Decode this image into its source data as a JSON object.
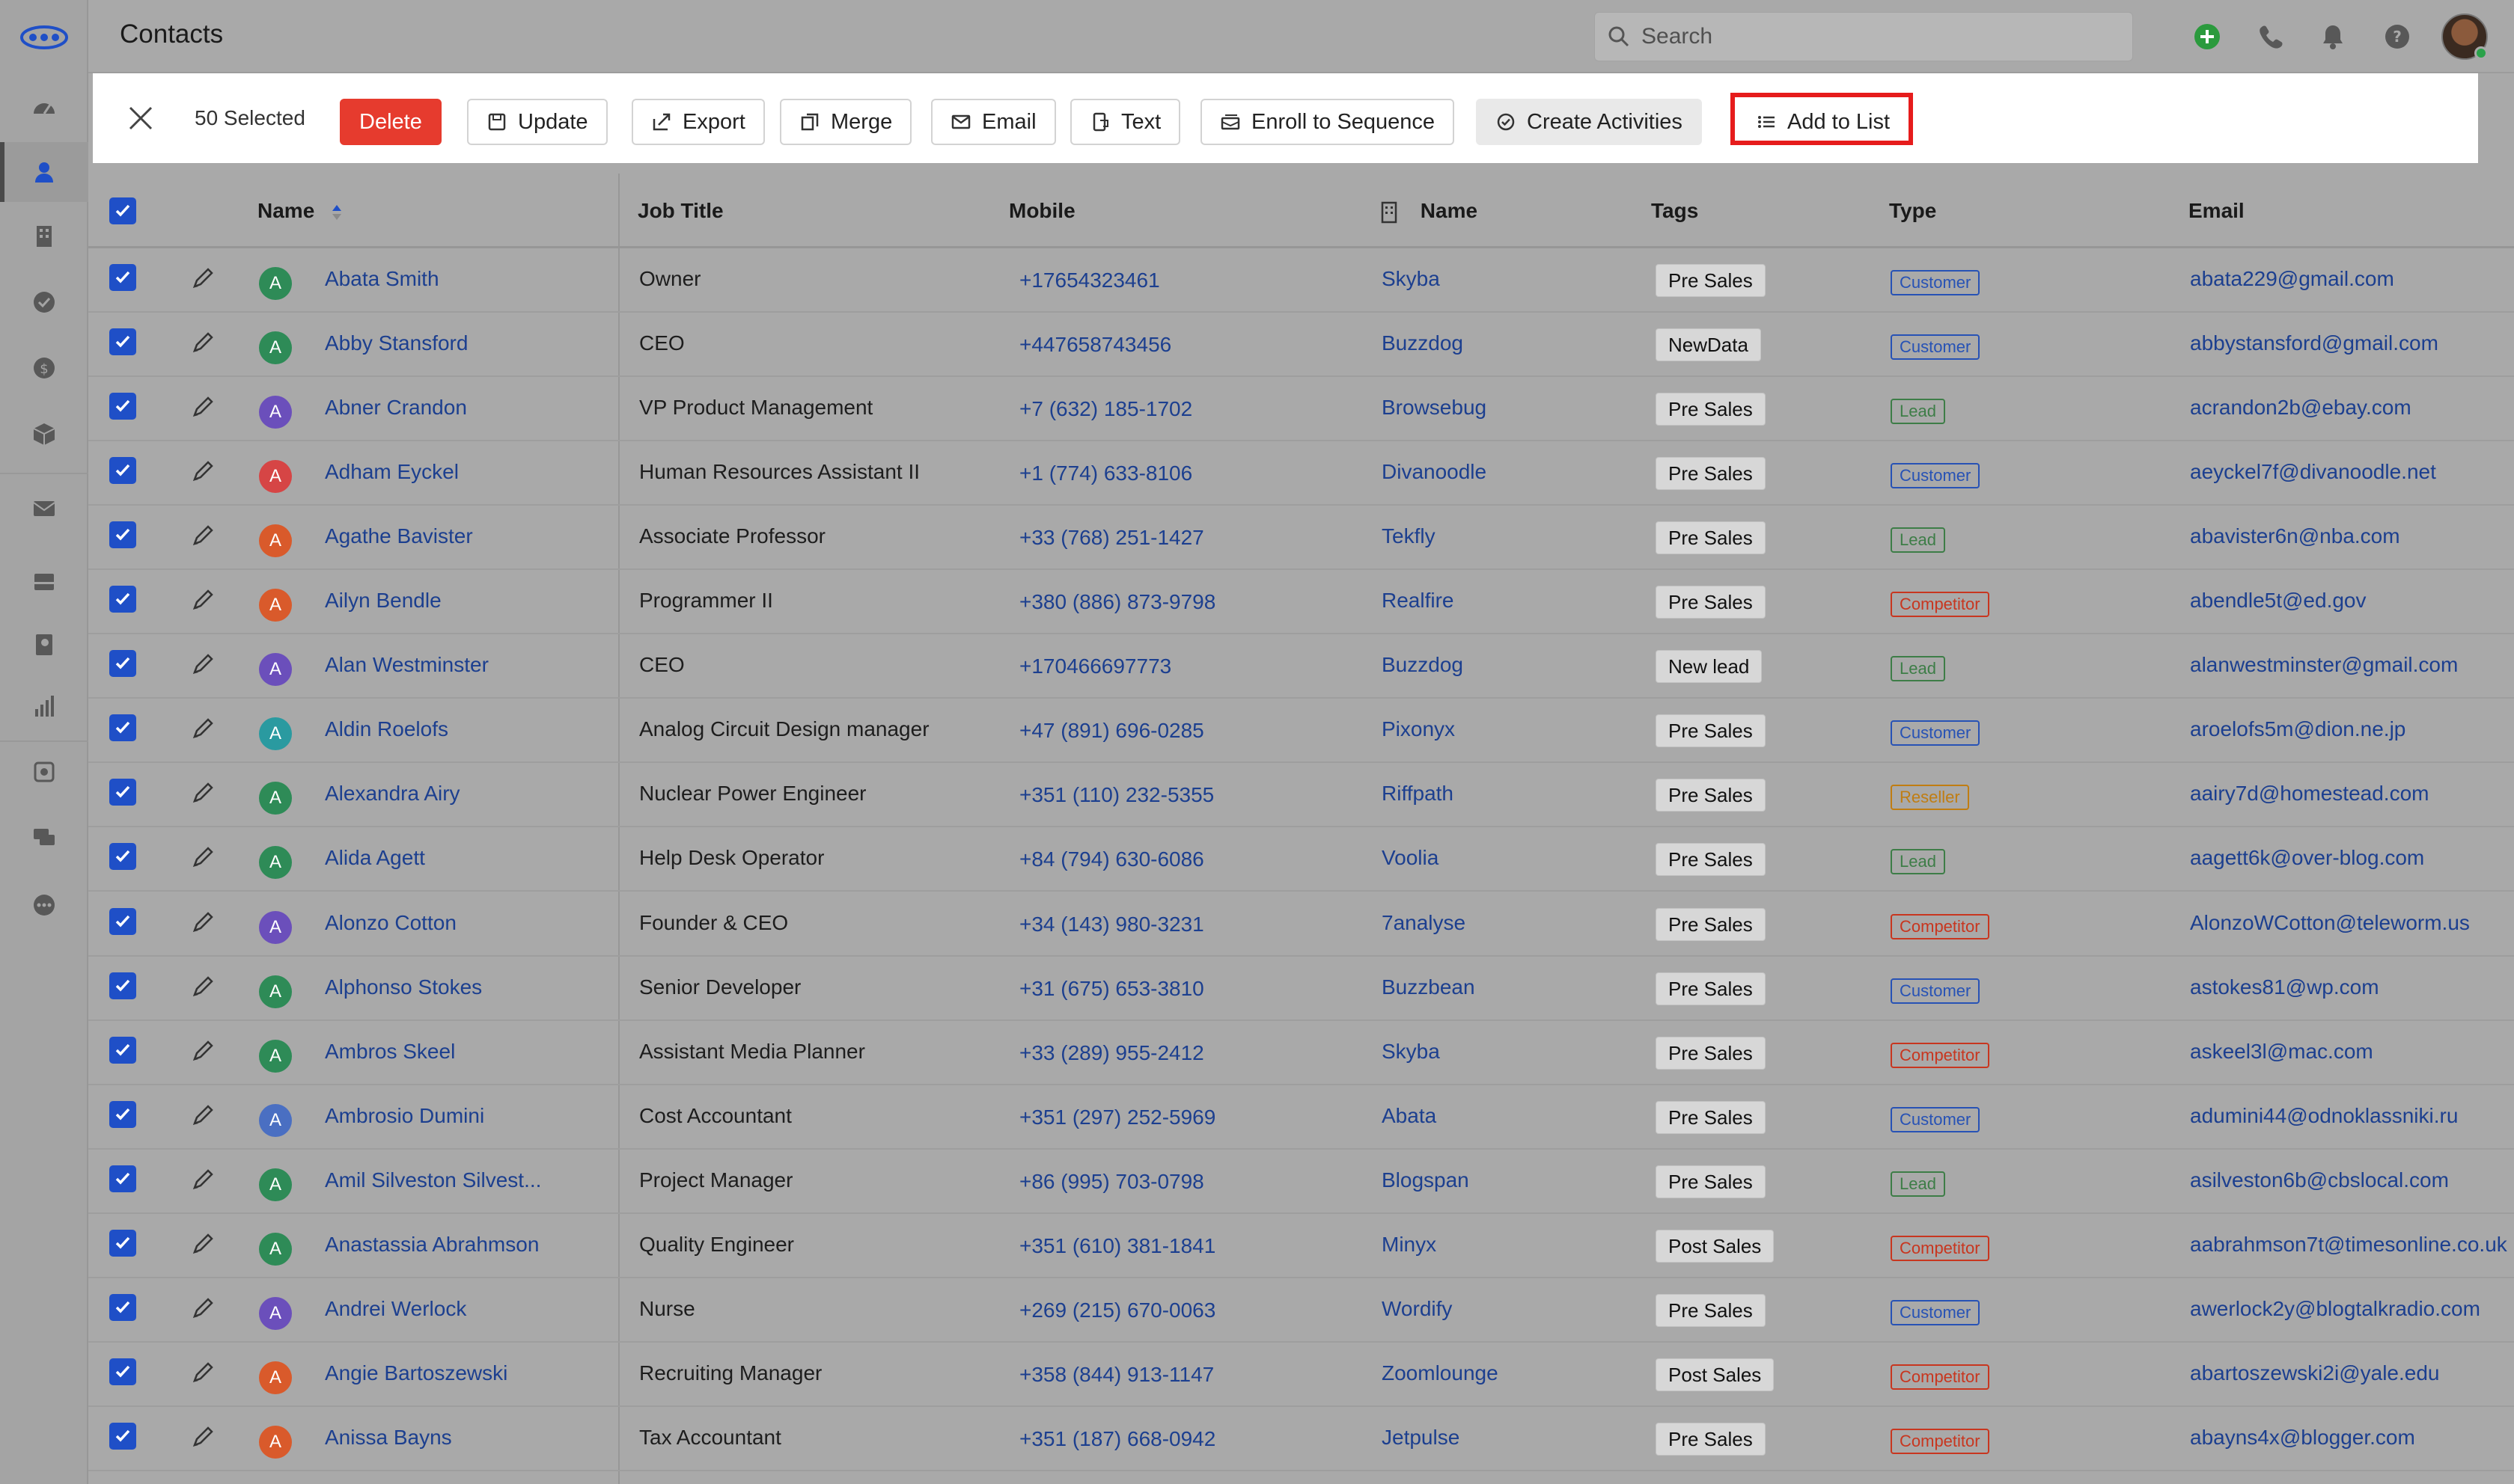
{
  "header": {
    "title": "Contacts",
    "search_placeholder": "Search"
  },
  "toolbar": {
    "selected_label": "50 Selected",
    "buttons": {
      "delete": "Delete",
      "update": "Update",
      "export": "Export",
      "merge": "Merge",
      "email": "Email",
      "text": "Text",
      "enroll": "Enroll to Sequence",
      "create_activities": "Create Activities",
      "add_to_list": "Add to List"
    }
  },
  "table": {
    "columns": {
      "name": "Name",
      "job_title": "Job Title",
      "mobile": "Mobile",
      "company_name": "Name",
      "tags": "Tags",
      "type": "Type",
      "email": "Email"
    },
    "rows": [
      {
        "initial": "A",
        "avatar": "#2e8b57",
        "name": "Abata Smith",
        "job": "Owner",
        "mobile": "+17654323461",
        "company": "Skyba",
        "tag": "Pre Sales",
        "type": "Customer",
        "email": "abata229@gmail.com"
      },
      {
        "initial": "A",
        "avatar": "#2e8b57",
        "name": "Abby Stansford",
        "job": "CEO",
        "mobile": "+447658743456",
        "company": "Buzzdog",
        "tag": "NewData",
        "type": "Customer",
        "email": "abbystansford@gmail.com"
      },
      {
        "initial": "A",
        "avatar": "#6b4fbb",
        "name": "Abner Crandon",
        "job": "VP Product Management",
        "mobile": "+7 (632) 185-1702",
        "company": "Browsebug",
        "tag": "Pre Sales",
        "type": "Lead",
        "email": "acrandon2b@ebay.com"
      },
      {
        "initial": "A",
        "avatar": "#d64545",
        "name": "Adham Eyckel",
        "job": "Human Resources Assistant II",
        "mobile": "+1 (774) 633-8106",
        "company": "Divanoodle",
        "tag": "Pre Sales",
        "type": "Customer",
        "email": "aeyckel7f@divanoodle.net"
      },
      {
        "initial": "A",
        "avatar": "#d95a2b",
        "name": "Agathe Bavister",
        "job": "Associate Professor",
        "mobile": "+33 (768) 251-1427",
        "company": "Tekfly",
        "tag": "Pre Sales",
        "type": "Lead",
        "email": "abavister6n@nba.com"
      },
      {
        "initial": "A",
        "avatar": "#d95a2b",
        "name": "Ailyn Bendle",
        "job": "Programmer II",
        "mobile": "+380 (886) 873-9798",
        "company": "Realfire",
        "tag": "Pre Sales",
        "type": "Competitor",
        "email": "abendle5t@ed.gov"
      },
      {
        "initial": "A",
        "avatar": "#6b4fbb",
        "name": "Alan Westminster",
        "job": "CEO",
        "mobile": "+170466697773",
        "company": "Buzzdog",
        "tag": "New lead",
        "type": "Lead",
        "email": "alanwestminster@gmail.com"
      },
      {
        "initial": "A",
        "avatar": "#2a9aa0",
        "name": "Aldin Roelofs",
        "job": "Analog Circuit Design manager",
        "mobile": "+47 (891) 696-0285",
        "company": "Pixonyx",
        "tag": "Pre Sales",
        "type": "Customer",
        "email": "aroelofs5m@dion.ne.jp"
      },
      {
        "initial": "A",
        "avatar": "#2e8b57",
        "name": "Alexandra Airy",
        "job": "Nuclear Power Engineer",
        "mobile": "+351 (110) 232-5355",
        "company": "Riffpath",
        "tag": "Pre Sales",
        "type": "Reseller",
        "email": "aairy7d@homestead.com"
      },
      {
        "initial": "A",
        "avatar": "#2e8b57",
        "name": "Alida Agett",
        "job": "Help Desk Operator",
        "mobile": "+84 (794) 630-6086",
        "company": "Voolia",
        "tag": "Pre Sales",
        "type": "Lead",
        "email": "aagett6k@over-blog.com"
      },
      {
        "initial": "A",
        "avatar": "#6b4fbb",
        "name": "Alonzo Cotton",
        "job": "Founder & CEO",
        "mobile": "+34 (143) 980-3231",
        "company": "7analyse",
        "tag": "Pre Sales",
        "type": "Competitor",
        "email": "AlonzoWCotton@teleworm.us"
      },
      {
        "initial": "A",
        "avatar": "#2e8b57",
        "name": "Alphonso Stokes",
        "job": "Senior Developer",
        "mobile": "+31 (675) 653-3810",
        "company": "Buzzbean",
        "tag": "Pre Sales",
        "type": "Customer",
        "email": "astokes81@wp.com"
      },
      {
        "initial": "A",
        "avatar": "#2e8b57",
        "name": "Ambros Skeel",
        "job": "Assistant Media Planner",
        "mobile": "+33 (289) 955-2412",
        "company": "Skyba",
        "tag": "Pre Sales",
        "type": "Competitor",
        "email": "askeel3l@mac.com"
      },
      {
        "initial": "A",
        "avatar": "#4a6fc2",
        "name": "Ambrosio Dumini",
        "job": "Cost Accountant",
        "mobile": "+351 (297) 252-5969",
        "company": "Abata",
        "tag": "Pre Sales",
        "type": "Customer",
        "email": "adumini44@odnoklassniki.ru"
      },
      {
        "initial": "A",
        "avatar": "#2e8b57",
        "name": "Amil Silveston Silvest...",
        "job": "Project Manager",
        "mobile": "+86 (995) 703-0798",
        "company": "Blogspan",
        "tag": "Pre Sales",
        "type": "Lead",
        "email": "asilveston6b@cbslocal.com"
      },
      {
        "initial": "A",
        "avatar": "#2e8b57",
        "name": "Anastassia Abrahmson",
        "job": "Quality Engineer",
        "mobile": "+351 (610) 381-1841",
        "company": "Minyx",
        "tag": "Post Sales",
        "type": "Competitor",
        "email": "aabrahmson7t@timesonline.co.uk"
      },
      {
        "initial": "A",
        "avatar": "#6b4fbb",
        "name": "Andrei Werlock",
        "job": "Nurse",
        "mobile": "+269 (215) 670-0063",
        "company": "Wordify",
        "tag": "Pre Sales",
        "type": "Customer",
        "email": "awerlock2y@blogtalkradio.com"
      },
      {
        "initial": "A",
        "avatar": "#d95a2b",
        "name": "Angie Bartoszewski",
        "job": "Recruiting Manager",
        "mobile": "+358 (844) 913-1147",
        "company": "Zoomlounge",
        "tag": "Post Sales",
        "type": "Competitor",
        "email": "abartoszewski2i@yale.edu"
      },
      {
        "initial": "A",
        "avatar": "#d95a2b",
        "name": "Anissa Bayns",
        "job": "Tax Accountant",
        "mobile": "+351 (187) 668-0942",
        "company": "Jetpulse",
        "tag": "Pre Sales",
        "type": "Competitor",
        "email": "abayns4x@blogger.com"
      }
    ]
  }
}
